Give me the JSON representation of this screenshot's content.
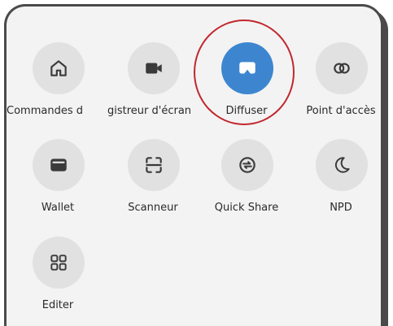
{
  "tiles": [
    {
      "label": "Commandes d",
      "icon": "home-icon"
    },
    {
      "label": "gistreur d'écran",
      "icon": "video-camera-icon"
    },
    {
      "label": "Diffuser",
      "icon": "cast-icon",
      "active": true
    },
    {
      "label": "Point d'accès",
      "icon": "hotspot-icon"
    },
    {
      "label": "Wallet",
      "icon": "wallet-icon"
    },
    {
      "label": "Scanneur",
      "icon": "scanner-icon"
    },
    {
      "label": "Quick Share",
      "icon": "quick-share-icon"
    },
    {
      "label": "NPD",
      "icon": "moon-icon"
    },
    {
      "label": "Éditer",
      "icon": "grid-edit-icon"
    }
  ],
  "colors": {
    "active": "#3d86cf",
    "inactive": "#e1e1e1",
    "highlight": "#c1272d",
    "panel": "#f3f3f3"
  }
}
